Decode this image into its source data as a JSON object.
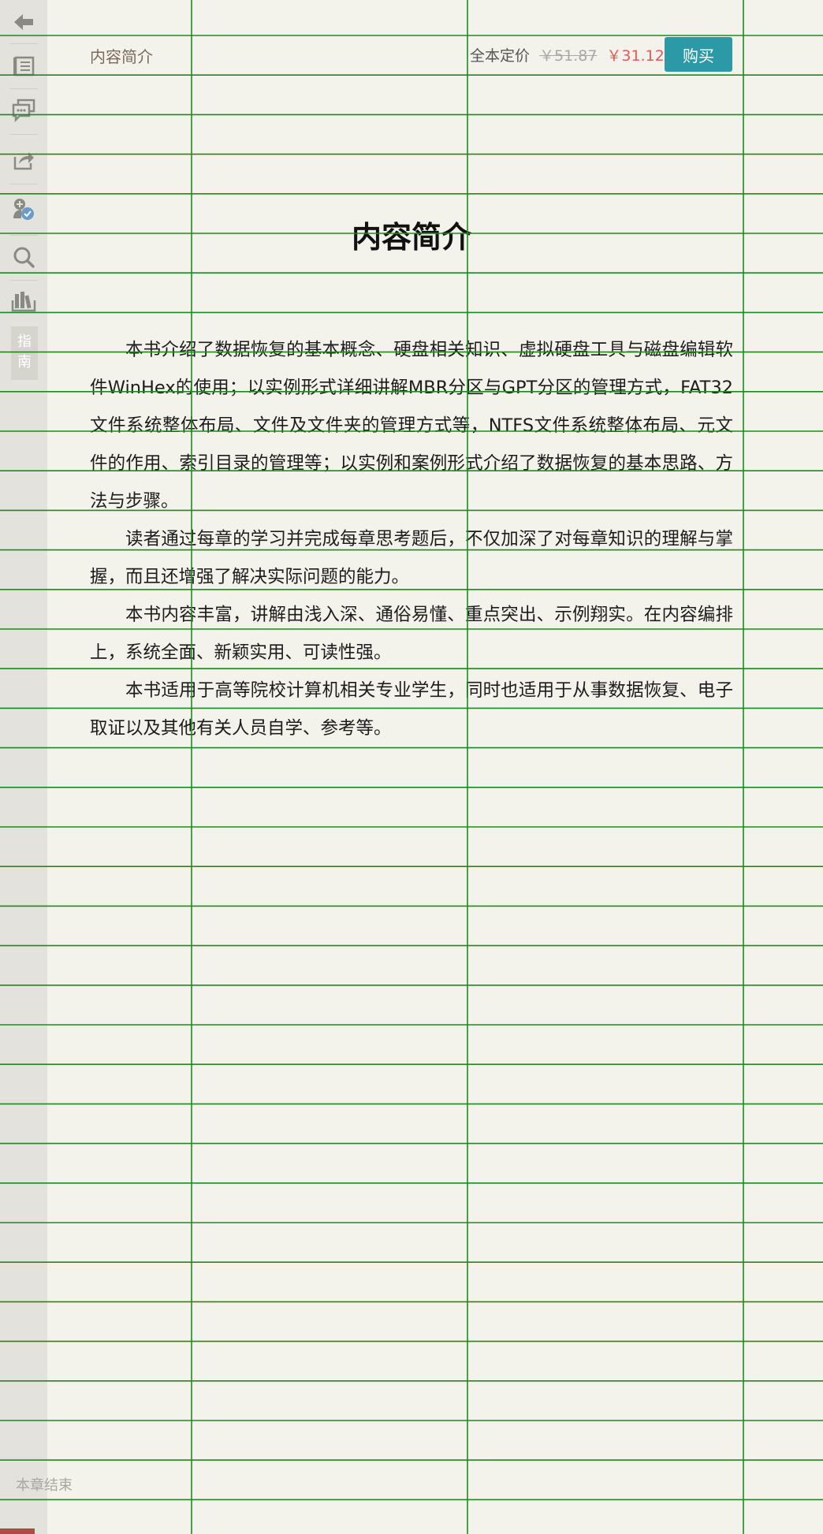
{
  "sidebar": {
    "icons": [
      {
        "name": "back-arrow-icon"
      },
      {
        "name": "table-of-contents-icon"
      },
      {
        "name": "comments-icon"
      },
      {
        "name": "share-icon"
      },
      {
        "name": "add-user-icon"
      },
      {
        "name": "search-icon"
      },
      {
        "name": "bookshelf-icon"
      }
    ],
    "guide_label_line1": "指",
    "guide_label_line2": "南"
  },
  "header": {
    "title": "内容简介",
    "price_label": "全本定价",
    "price_original": "￥51.87",
    "price_current": "￥31.12",
    "buy_label": "购买"
  },
  "chapter": {
    "title": "内容简介",
    "paragraphs": [
      "本书介绍了数据恢复的基本概念、硬盘相关知识、虚拟硬盘工具与磁盘编辑软件WinHex的使用；以实例形式详细讲解MBR分区与GPT分区的管理方式，FAT32文件系统整体布局、文件及文件夹的管理方式等，NTFS文件系统整体布局、元文件的作用、索引目录的管理等；以实例和案例形式介绍了数据恢复的基本思路、方法与步骤。",
      "读者通过每章的学习并完成每章思考题后，不仅加深了对每章知识的理解与掌握，而且还增强了解决实际问题的能力。",
      "本书内容丰富，讲解由浅入深、通俗易懂、重点突出、示例翔实。在内容编排上，系统全面、新颖实用、可读性强。",
      "本书适用于高等院校计算机相关专业学生，同时也适用于从事数据恢复、电子取证以及其他有关人员自学、参考等。"
    ],
    "end_label": "本章结束"
  },
  "colors": {
    "background": "#f4f3eb",
    "sidebar": "#e3e2dc",
    "accent": "#2c9aa6",
    "price_current": "#e25a57",
    "grid_line": "#1e8a1e"
  }
}
